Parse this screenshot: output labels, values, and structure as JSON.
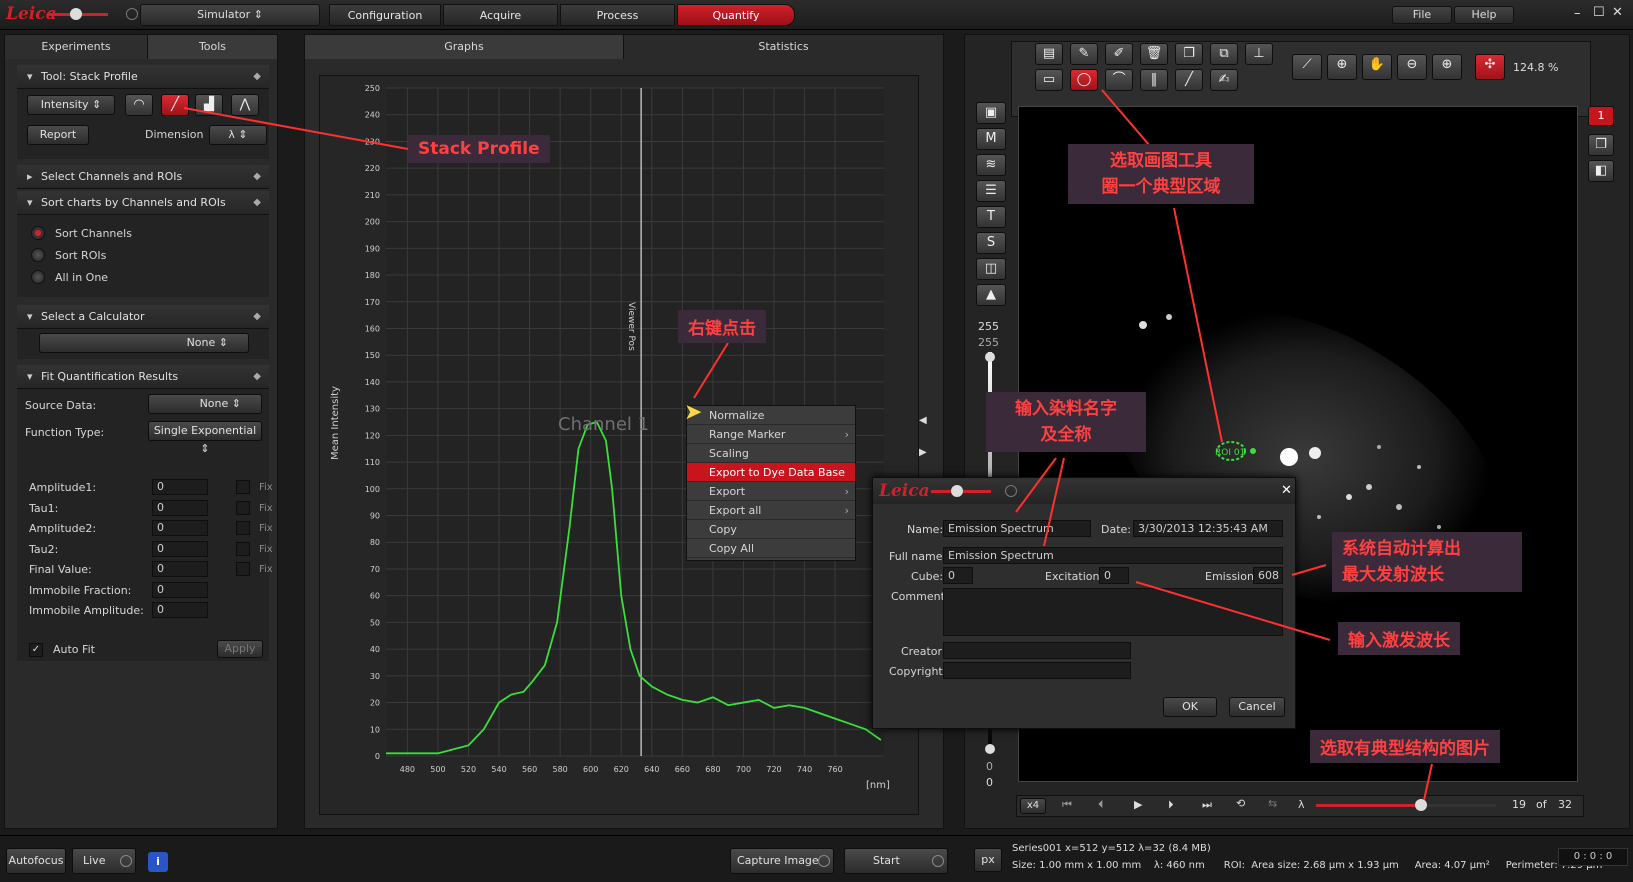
{
  "topbar": {
    "logo": "Leica",
    "mode": "Simulator",
    "crumbs": [
      "Configuration",
      "Acquire",
      "Process",
      "Quantify"
    ],
    "menu": [
      "File",
      "Help"
    ],
    "win": [
      "–",
      "☐",
      "✕"
    ]
  },
  "left": {
    "tabs": [
      "Experiments",
      "Tools"
    ],
    "tool_header": "Tool: Stack Profile",
    "intensity": "Intensity",
    "report": "Report",
    "dimension_label": "Dimension",
    "dimension_value": "λ",
    "select_channels": "Select Channels and ROIs",
    "sort_header": "Sort charts by Channels and ROIs",
    "sort_options": [
      "Sort Channels",
      "Sort ROIs",
      "All in One"
    ],
    "calc_header": "Select a Calculator",
    "calc_value": "None",
    "fit_header": "Fit Quantification Results",
    "source_label": "Source Data:",
    "source_value": "None",
    "func_label": "Function Type:",
    "func_value": "Single Exponential",
    "params": [
      {
        "label": "Amplitude1:",
        "value": "0",
        "fix": "Fix"
      },
      {
        "label": "Tau1:",
        "value": "0",
        "fix": "Fix"
      },
      {
        "label": "Amplitude2:",
        "value": "0",
        "fix": "Fix"
      },
      {
        "label": "Tau2:",
        "value": "0",
        "fix": "Fix"
      },
      {
        "label": "Final Value:",
        "value": "0",
        "fix": "Fix"
      },
      {
        "label": "Immobile Fraction:",
        "value": "0",
        "fix": ""
      },
      {
        "label": "Immobile Amplitude:",
        "value": "0",
        "fix": ""
      }
    ],
    "autofit": "Auto Fit",
    "apply": "Apply"
  },
  "center": {
    "tabs": [
      "Graphs",
      "Statistics"
    ],
    "channel_label": "Channel 1",
    "viewer_pos": "Viewer Pos"
  },
  "chart_data": {
    "type": "line",
    "title": "",
    "xlabel": "[nm]",
    "ylabel": "Mean Intensity",
    "xlim": [
      466,
      792
    ],
    "ylim": [
      0,
      250
    ],
    "x_ticks": [
      480,
      500,
      520,
      540,
      560,
      580,
      600,
      620,
      640,
      660,
      680,
      700,
      720,
      740,
      760
    ],
    "y_ticks": [
      0,
      10,
      20,
      30,
      40,
      50,
      60,
      70,
      80,
      90,
      100,
      110,
      120,
      130,
      140,
      150,
      160,
      170,
      180,
      190,
      200,
      210,
      220,
      230,
      240,
      250
    ],
    "grid": true,
    "series": [
      {
        "color": "#3adf3a",
        "x": [
          466,
          480,
          500,
          520,
          530,
          540,
          548,
          556,
          562,
          570,
          578,
          586,
          592,
          598,
          604,
          610,
          614,
          620,
          626,
          632,
          640,
          650,
          660,
          670,
          680,
          690,
          700,
          710,
          720,
          730,
          740,
          750,
          760,
          770,
          780,
          790
        ],
        "y": [
          1,
          1,
          1,
          4,
          10,
          20,
          23,
          24,
          28,
          34,
          50,
          85,
          115,
          124,
          125,
          118,
          100,
          60,
          40,
          30,
          26,
          23,
          21,
          20,
          22,
          19,
          20,
          21,
          18,
          19,
          18,
          16,
          14,
          12,
          10,
          6
        ]
      }
    ],
    "marker_x": 633
  },
  "context_menu": [
    {
      "label": "Normalize",
      "arrow": ""
    },
    {
      "label": "Range Marker",
      "arrow": "›"
    },
    {
      "label": "Scaling",
      "arrow": ""
    },
    {
      "label": "Export to Dye Data Base",
      "arrow": ""
    },
    {
      "label": "Export",
      "arrow": "›"
    },
    {
      "label": "Export all",
      "arrow": "›"
    },
    {
      "label": "Copy",
      "arrow": ""
    },
    {
      "label": "Copy All",
      "arrow": ""
    }
  ],
  "dialog": {
    "logo": "Leica",
    "name_label": "Name:",
    "name_value": "Emission Spectrum",
    "date_label": "Date:",
    "date_value": "3/30/2013 12:35:43 AM",
    "fullname_label": "Full name:",
    "fullname_value": "Emission Spectrum",
    "cube_label": "Cube:",
    "cube_value": "0",
    "excitation_label": "Excitation:",
    "excitation_value": "0",
    "emission_label": "Emission:",
    "emission_value": "608",
    "comment_label": "Comment:",
    "creator_label": "Creator:",
    "copyright_label": "Copyright:",
    "ok": "OK",
    "cancel": "Cancel"
  },
  "viewer": {
    "zoom": "124.8 %",
    "lut_top": "255",
    "lut_top2": "255",
    "lut_bottom": "0",
    "lut_bottom2": "0",
    "frame_prefix": "x4",
    "lambda": "λ",
    "frame_current": "19",
    "frame_of": "of",
    "frame_total": "32",
    "channel_badge": "1",
    "roi_label": "ROI 01"
  },
  "annotations": {
    "stack_profile": "Stack Profile",
    "right_click": "右键点击",
    "draw_tool_1": "选取画图工具",
    "draw_tool_2": "圈一个典型区域",
    "dye_name_1": "输入染料名字",
    "dye_name_2": "及全称",
    "auto_calc_1": "系统自动计算出",
    "auto_calc_2": "最大发射波长",
    "excitation": "输入激发波长",
    "pick_image": "选取有典型结构的图片"
  },
  "bottom": {
    "autofocus": "Autofocus",
    "live": "Live",
    "capture": "Capture Image",
    "start": "Start",
    "px": "px",
    "status1": "Series001 x=512 y=512 λ=32 (8.4 MB)",
    "status2": "Size: 1.00 mm x 1.00 mm    λ: 460 nm      ROI:  Area size: 2.68 µm x 1.93 µm     Area: 4.07 µm²     Perimeter: 7.29 µm",
    "timer": "0 : 0 : 0"
  }
}
